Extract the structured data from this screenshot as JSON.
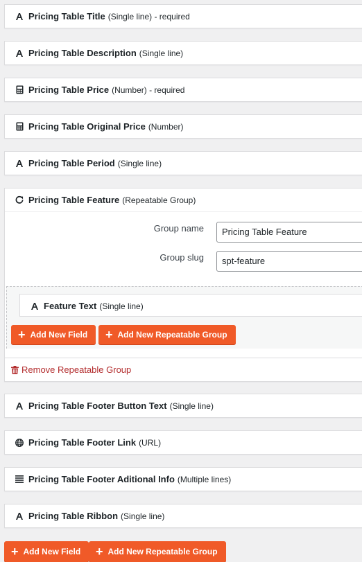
{
  "fields_top": [
    {
      "name": "Pricing Table Title",
      "type": "(Single line) - required",
      "icon": "text-a-icon"
    },
    {
      "name": "Pricing Table Description",
      "type": "(Single line)",
      "icon": "text-a-icon"
    },
    {
      "name": "Pricing Table Price",
      "type": "(Number) - required",
      "icon": "calculator-icon"
    },
    {
      "name": "Pricing Table Original Price",
      "type": "(Number)",
      "icon": "calculator-icon"
    },
    {
      "name": "Pricing Table Period",
      "type": "(Single line)",
      "icon": "text-a-icon"
    }
  ],
  "repeatable_group": {
    "name": "Pricing Table Feature",
    "type": "(Repeatable Group)",
    "icon": "repeat-icon",
    "group_name_label": "Group name",
    "group_name_value": "Pricing Table Feature",
    "group_slug_label": "Group slug",
    "group_slug_value": "spt-feature",
    "nested_field": {
      "name": "Feature Text",
      "type": "(Single line)",
      "icon": "text-a-icon"
    },
    "add_field_label": "Add New Field",
    "add_group_label": "Add New Repeatable Group",
    "remove_label": "Remove Repeatable Group"
  },
  "fields_bottom": [
    {
      "name": "Pricing Table Footer Button Text",
      "type": "(Single line)",
      "icon": "text-a-icon"
    },
    {
      "name": "Pricing Table Footer Link",
      "type": "(URL)",
      "icon": "globe-icon"
    },
    {
      "name": "Pricing Table Footer Aditional Info",
      "type": "(Multiple lines)",
      "icon": "text-lines-icon"
    },
    {
      "name": "Pricing Table Ribbon",
      "type": "(Single line)",
      "icon": "text-a-icon"
    }
  ],
  "footer_buttons": {
    "add_field_label": "Add New Field",
    "add_group_label": "Add New Repeatable Group"
  },
  "colors": {
    "accent": "#f05a28",
    "danger": "#b32d2e",
    "background": "#f0f0f1"
  }
}
